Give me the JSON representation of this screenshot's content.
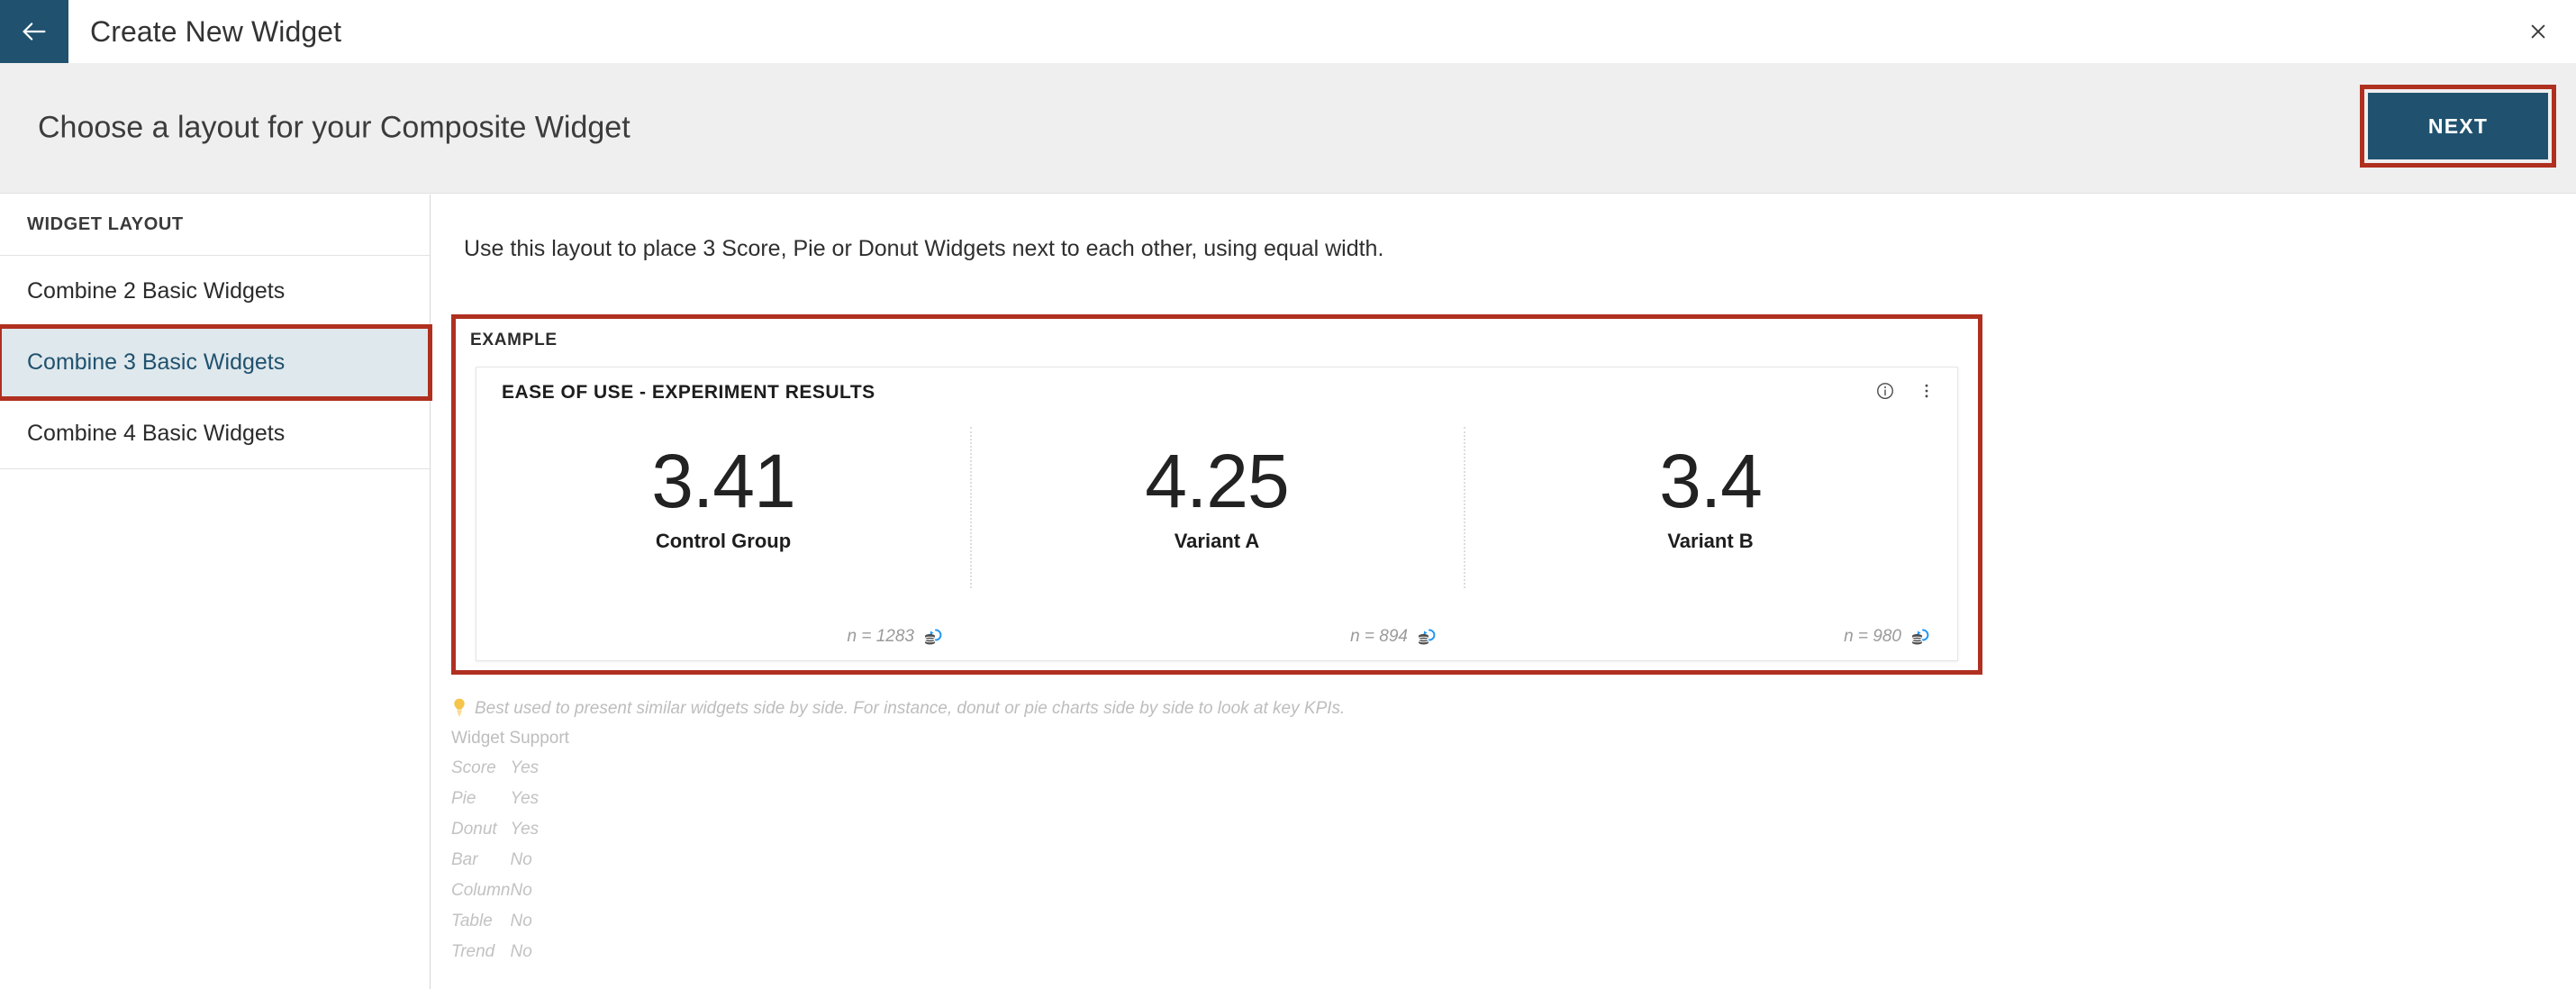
{
  "topbar": {
    "back_icon": "arrow-left-icon",
    "title": "Create New Widget",
    "close_icon": "close-icon"
  },
  "subheader": {
    "title": "Choose a layout for your Composite Widget",
    "next_label": "NEXT",
    "highlight_color": "#b03020",
    "button_color": "#20526f"
  },
  "sidebar": {
    "heading": "WIDGET LAYOUT",
    "items": [
      {
        "label": "Combine 2 Basic Widgets",
        "selected": false,
        "highlighted": false
      },
      {
        "label": "Combine 3 Basic Widgets",
        "selected": true,
        "highlighted": true
      },
      {
        "label": "Combine 4 Basic Widgets",
        "selected": false,
        "highlighted": false
      }
    ]
  },
  "main": {
    "description": "Use this layout to place 3 Score, Pie or Donut Widgets next to each other, using equal width.",
    "example_label": "EXAMPLE",
    "widget": {
      "title": "EASE OF USE - EXPERIMENT RESULTS",
      "info_icon": "info-icon",
      "menu_icon": "more-vertical-icon",
      "panels": [
        {
          "value": "3.41",
          "label": "Control Group",
          "n": "n = 1283",
          "source_icon": "database-refresh-icon"
        },
        {
          "value": "4.25",
          "label": "Variant A",
          "n": "n = 894",
          "source_icon": "database-refresh-icon"
        },
        {
          "value": "3.4",
          "label": "Variant B",
          "n": "n = 980",
          "source_icon": "database-refresh-icon"
        }
      ]
    },
    "tip": "Best used to present similar widgets side by side. For instance, donut or pie charts side by side to look at key KPIs.",
    "tip_icon": "lightbulb-icon",
    "support_title": "Widget Support",
    "support_rows": [
      {
        "widget": "Score",
        "supported": "Yes"
      },
      {
        "widget": "Pie",
        "supported": "Yes"
      },
      {
        "widget": "Donut",
        "supported": "Yes"
      },
      {
        "widget": "Bar",
        "supported": "No"
      },
      {
        "widget": "Column",
        "supported": "No"
      },
      {
        "widget": "Table",
        "supported": "No"
      },
      {
        "widget": "Trend",
        "supported": "No"
      }
    ]
  },
  "chart_data": {
    "type": "bar",
    "title": "EASE OF USE - EXPERIMENT RESULTS",
    "categories": [
      "Control Group",
      "Variant A",
      "Variant B"
    ],
    "values": [
      3.41,
      4.25,
      3.4
    ],
    "sample_sizes": [
      1283,
      894,
      980
    ],
    "xlabel": "",
    "ylabel": "",
    "ylim": [
      0,
      5
    ],
    "legend": "none",
    "grid": false
  }
}
